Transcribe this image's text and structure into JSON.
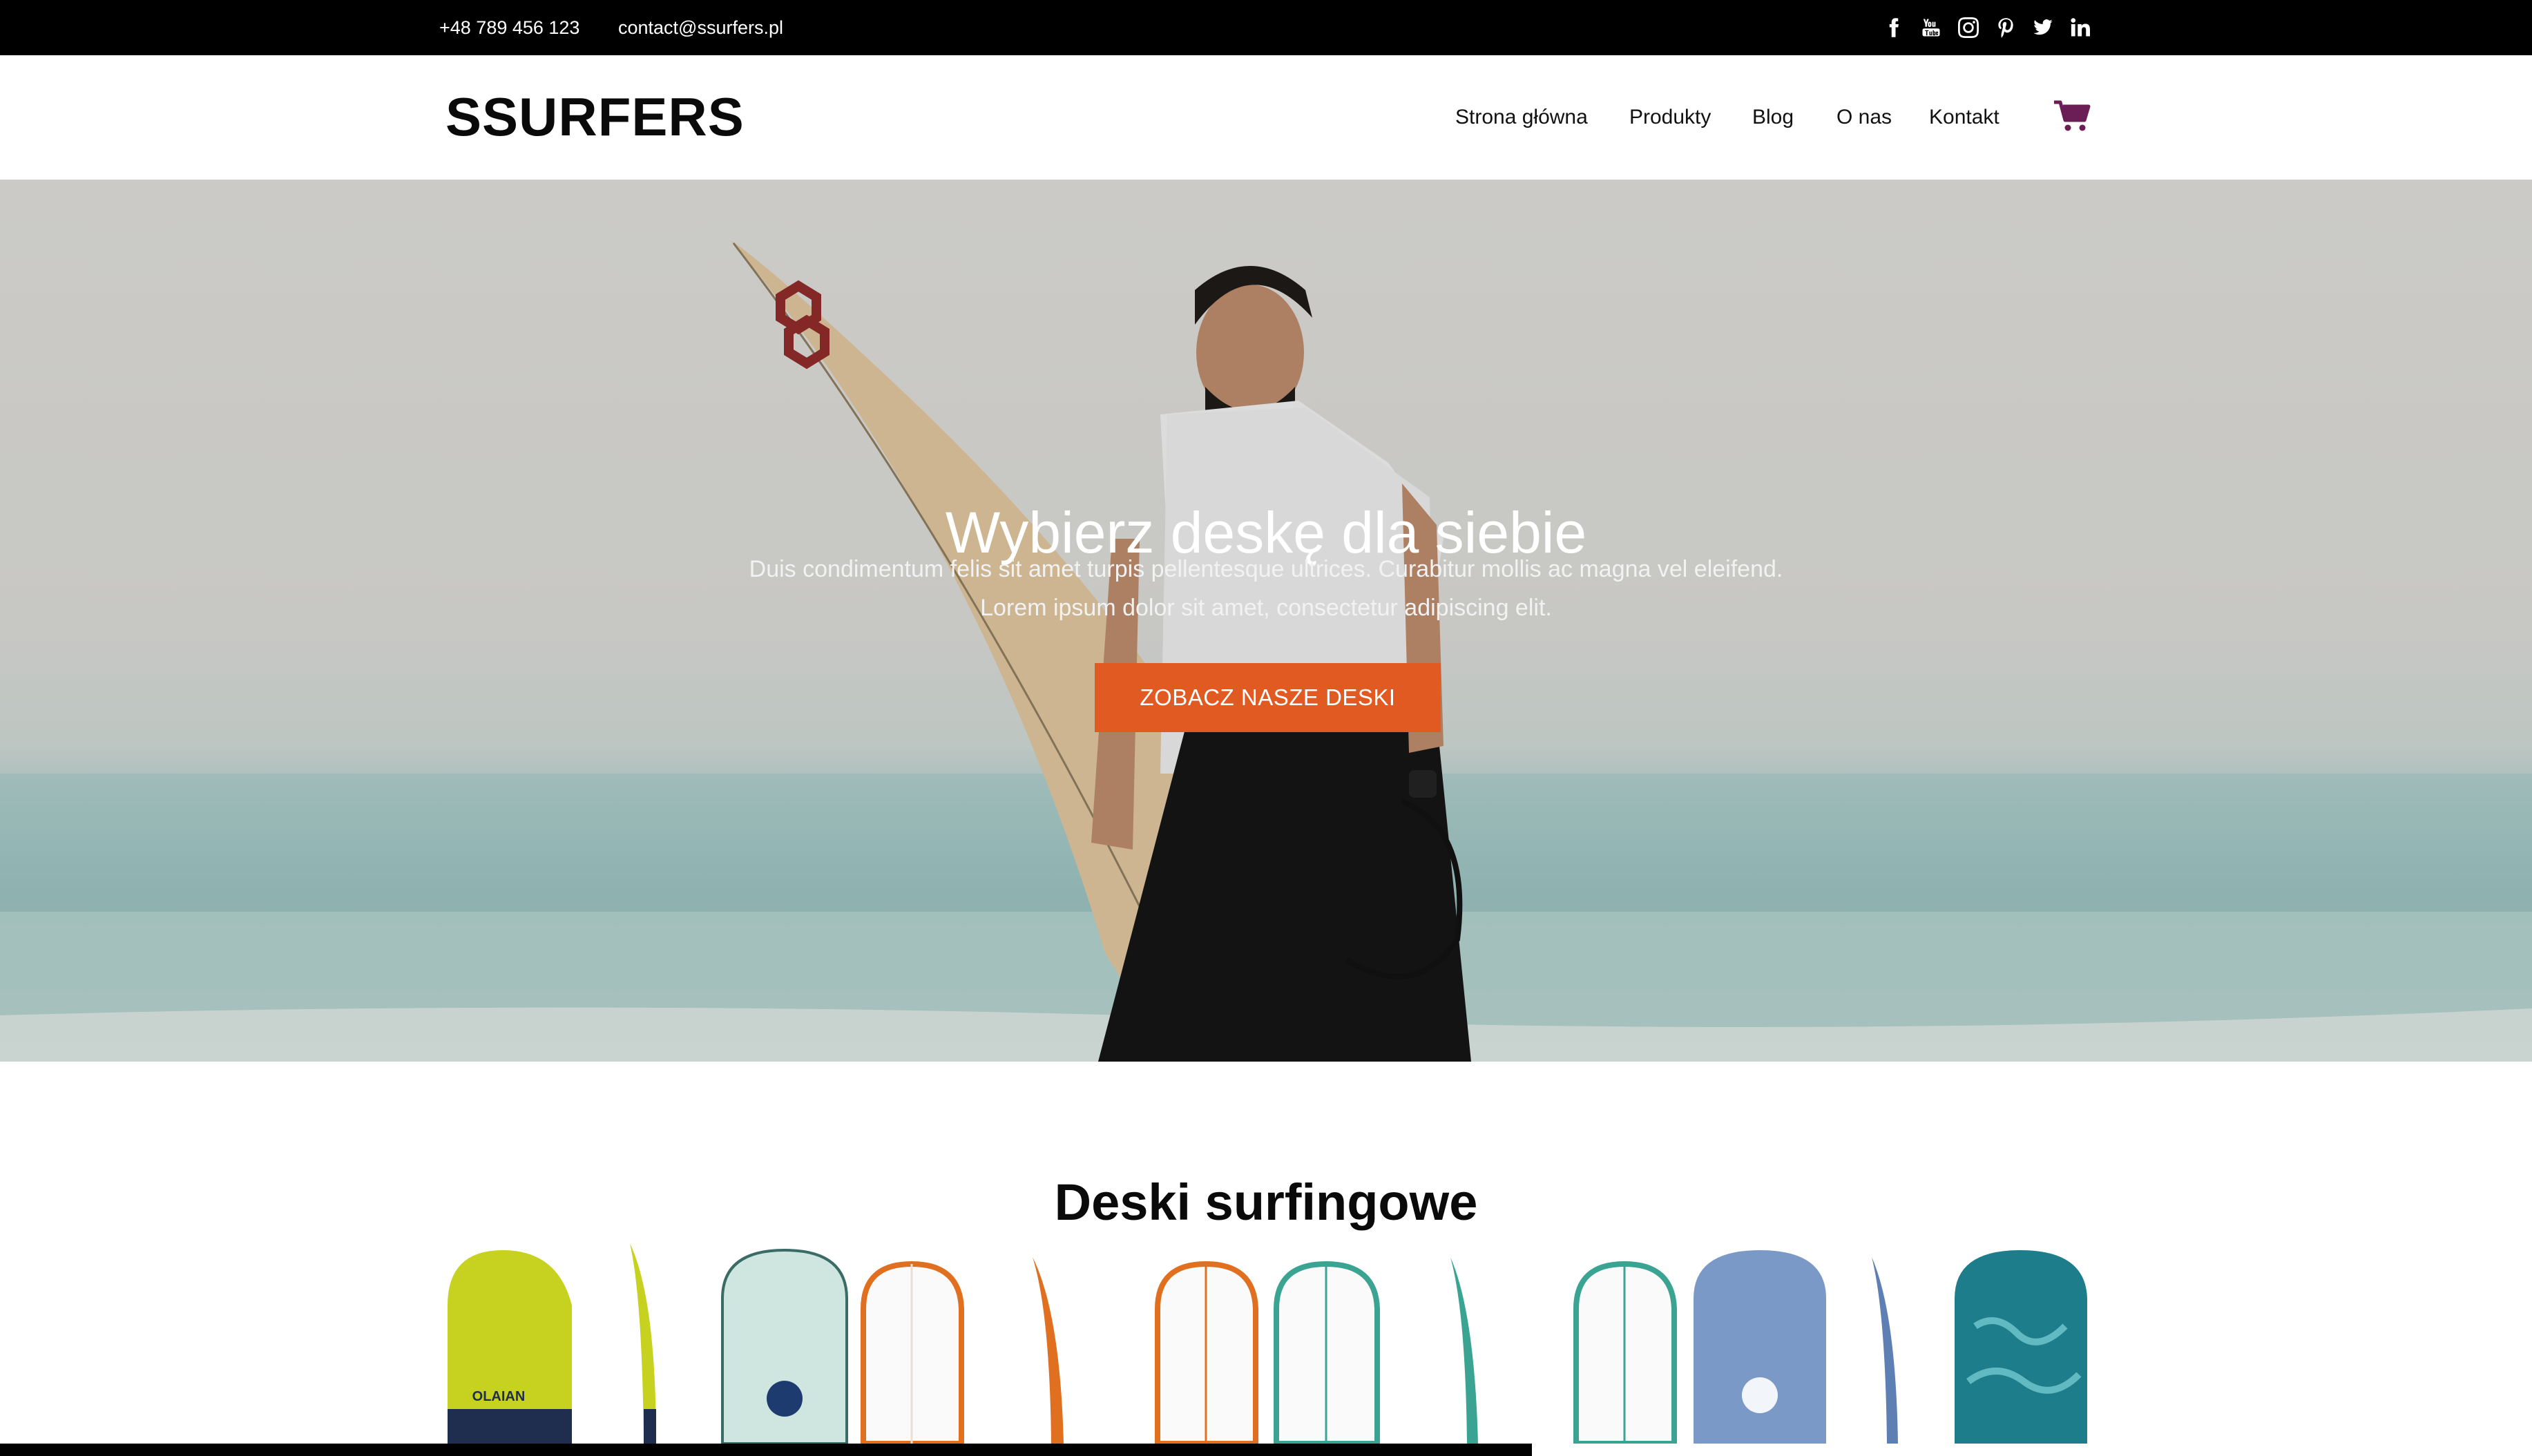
{
  "topbar": {
    "phone": "+48 789 456 123",
    "email": "contact@ssurfers.pl",
    "social": [
      "facebook-icon",
      "youtube-icon",
      "instagram-icon",
      "pinterest-icon",
      "twitter-icon",
      "linkedin-icon"
    ]
  },
  "header": {
    "logo": "SSURFERS",
    "nav": [
      "Strona główna",
      "Produkty",
      "Blog",
      "O nas",
      "Kontakt"
    ],
    "cart_icon": "cart-icon",
    "cart_color": "#6b1d55"
  },
  "hero": {
    "title": "Wybierz deskę dla siebie",
    "subtitle_line1": "Duis condimentum felis sit amet turpis pellentesque ultrices. Curabitur mollis ac magna vel eleifend.",
    "subtitle_line2": "Lorem ipsum dolor sit amet, consectetur adipiscing elit.",
    "button": "ZOBACZ NASZE DESKI",
    "button_color": "#e05a22"
  },
  "products": {
    "title": "Deski surfingowe",
    "board_brand": "OLAIAN"
  }
}
